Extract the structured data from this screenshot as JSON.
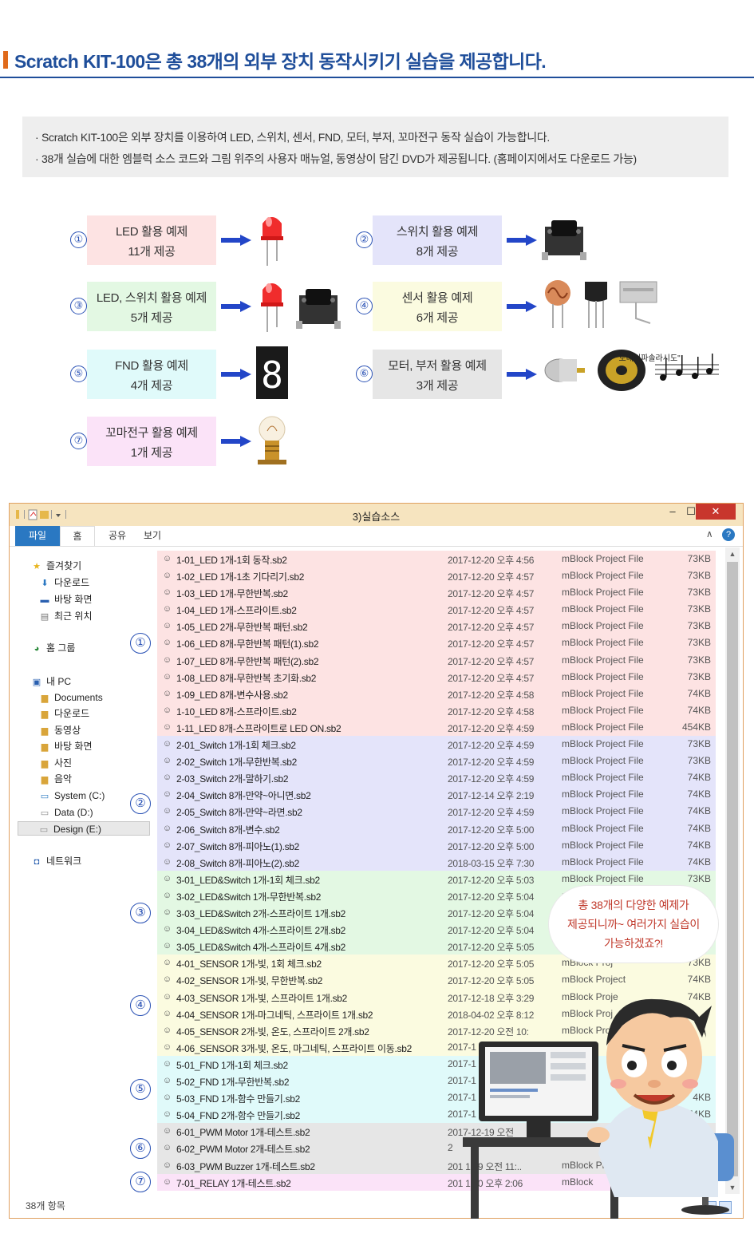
{
  "header": {
    "title": "Scratch KIT-100은 총 38개의 외부 장치 동작시키기 실습을 제공합니다."
  },
  "info": {
    "line1": "· Scratch KIT-100은 외부 장치를 이용하여 LED, 스위치, 센서, FND, 모터, 부저, 꼬마전구 동작 실습이 가능합니다.",
    "line2": "· 38개 실습에 대한 엠블럭 소스 코드와 그림 위주의 사용자 매뉴얼, 동영상이 담긴 DVD가 제공됩니다. (홈페이지에서도 다운로드 가능)"
  },
  "examples": [
    {
      "num": "①",
      "line1": "LED 활용 예제",
      "line2": "11개 제공",
      "color": "#fde3e3"
    },
    {
      "num": "②",
      "line1": "스위치 활용 예제",
      "line2": "8개 제공",
      "color": "#e4e4fa"
    },
    {
      "num": "③",
      "line1": "LED, 스위치 활용 예제",
      "line2": "5개 제공",
      "color": "#e3f8e3"
    },
    {
      "num": "④",
      "line1": "센서 활용 예제",
      "line2": "6개 제공",
      "color": "#fbfbe0"
    },
    {
      "num": "⑤",
      "line1": "FND 활용 예제",
      "line2": "4개 제공",
      "color": "#e0fafa"
    },
    {
      "num": "⑥",
      "line1": "모터, 부저 활용 예제",
      "line2": "3개 제공",
      "color": "#e6e6e6"
    },
    {
      "num": "⑦",
      "line1": "꼬마전구 활용 예제",
      "line2": "1개 제공",
      "color": "#fbe3f8"
    }
  ],
  "buzzer_label": "\"도레미파솔라시도\"",
  "led7seg": "8",
  "explorer": {
    "title": "3)실습소스",
    "tabs": {
      "file": "파일",
      "home": "홈",
      "share": "공유",
      "view": "보기"
    },
    "nav": {
      "favorites": "즐겨찾기",
      "downloads": "다운로드",
      "desktop": "바탕 화면",
      "recent": "최근 위치",
      "homegroup": "홈 그룹",
      "pc": "내 PC",
      "documents": "Documents",
      "pc_downloads": "다운로드",
      "videos": "동영상",
      "pc_desktop": "바탕 화면",
      "pictures": "사진",
      "music": "음악",
      "system": "System (C:)",
      "data": "Data (D:)",
      "design": "Design (E:)",
      "network": "네트워크"
    },
    "status": "38개 항목",
    "groups": [
      {
        "num": "①",
        "color": "#fde3e3",
        "files": [
          {
            "name": "1-01_LED 1개-1회 동작.sb2",
            "date": "2017-12-20 오후 4:56",
            "type": "mBlock Project File",
            "size": "73KB"
          },
          {
            "name": "1-02_LED 1개-1초 기다리기.sb2",
            "date": "2017-12-20 오후 4:57",
            "type": "mBlock Project File",
            "size": "73KB"
          },
          {
            "name": "1-03_LED 1개-무한반복.sb2",
            "date": "2017-12-20 오후 4:57",
            "type": "mBlock Project File",
            "size": "73KB"
          },
          {
            "name": "1-04_LED 1개-스프라이트.sb2",
            "date": "2017-12-20 오후 4:57",
            "type": "mBlock Project File",
            "size": "73KB"
          },
          {
            "name": "1-05_LED 2개-무한반복 패턴.sb2",
            "date": "2017-12-20 오후 4:57",
            "type": "mBlock Project File",
            "size": "73KB"
          },
          {
            "name": "1-06_LED 8개-무한반복 패턴(1).sb2",
            "date": "2017-12-20 오후 4:57",
            "type": "mBlock Project File",
            "size": "73KB"
          },
          {
            "name": "1-07_LED 8개-무한반복 패턴(2).sb2",
            "date": "2017-12-20 오후 4:57",
            "type": "mBlock Project File",
            "size": "73KB"
          },
          {
            "name": "1-08_LED 8개-무한반복 초기화.sb2",
            "date": "2017-12-20 오후 4:57",
            "type": "mBlock Project File",
            "size": "73KB"
          },
          {
            "name": "1-09_LED 8개-변수사용.sb2",
            "date": "2017-12-20 오후 4:58",
            "type": "mBlock Project File",
            "size": "74KB"
          },
          {
            "name": "1-10_LED 8개-스프라이트.sb2",
            "date": "2017-12-20 오후 4:58",
            "type": "mBlock Project File",
            "size": "74KB"
          },
          {
            "name": "1-11_LED 8개-스프라이트로 LED ON.sb2",
            "date": "2017-12-20 오후 4:59",
            "type": "mBlock Project File",
            "size": "454KB"
          }
        ]
      },
      {
        "num": "②",
        "color": "#e4e4fa",
        "files": [
          {
            "name": "2-01_Switch 1개-1회 체크.sb2",
            "date": "2017-12-20 오후 4:59",
            "type": "mBlock Project File",
            "size": "73KB"
          },
          {
            "name": "2-02_Switch 1개-무한반복.sb2",
            "date": "2017-12-20 오후 4:59",
            "type": "mBlock Project File",
            "size": "73KB"
          },
          {
            "name": "2-03_Switch 2개-말하기.sb2",
            "date": "2017-12-20 오후 4:59",
            "type": "mBlock Project File",
            "size": "74KB"
          },
          {
            "name": "2-04_Switch 8개-만약~아니면.sb2",
            "date": "2017-12-14 오후 2:19",
            "type": "mBlock Project File",
            "size": "74KB"
          },
          {
            "name": "2-05_Switch 8개-만약~라면.sb2",
            "date": "2017-12-20 오후 4:59",
            "type": "mBlock Project File",
            "size": "74KB"
          },
          {
            "name": "2-06_Switch 8개-변수.sb2",
            "date": "2017-12-20 오후 5:00",
            "type": "mBlock Project File",
            "size": "74KB"
          },
          {
            "name": "2-07_Switch 8개-피아노(1).sb2",
            "date": "2017-12-20 오후 5:00",
            "type": "mBlock Project File",
            "size": "74KB"
          },
          {
            "name": "2-08_Switch 8개-피아노(2).sb2",
            "date": "2018-03-15 오후 7:30",
            "type": "mBlock Project File",
            "size": "74KB"
          }
        ]
      },
      {
        "num": "③",
        "color": "#e3f8e3",
        "files": [
          {
            "name": "3-01_LED&Switch 1개-1회 체크.sb2",
            "date": "2017-12-20 오후 5:03",
            "type": "mBlock Project File",
            "size": "73KB"
          },
          {
            "name": "3-02_LED&Switch 1개-무한반복.sb2",
            "date": "2017-12-20 오후 5:04",
            "type": "m",
            "size": ""
          },
          {
            "name": "3-03_LED&Switch 2개-스프라이트 1개.sb2",
            "date": "2017-12-20 오후 5:04",
            "type": "",
            "size": ""
          },
          {
            "name": "3-04_LED&Switch 4개-스프라이트 2개.sb2",
            "date": "2017-12-20 오후 5:04",
            "type": "",
            "size": ""
          },
          {
            "name": "3-05_LED&Switch 4개-스프라이트 4개.sb2",
            "date": "2017-12-20 오후 5:05",
            "type": "",
            "size": ""
          }
        ]
      },
      {
        "num": "④",
        "color": "#fbfbe0",
        "files": [
          {
            "name": "4-01_SENSOR 1개-빛, 1회 체크.sb2",
            "date": "2017-12-20 오후 5:05",
            "type": "mBlock Proj",
            "size": "73KB"
          },
          {
            "name": "4-02_SENSOR 1개-빛, 무한반복.sb2",
            "date": "2017-12-20 오후 5:05",
            "type": "mBlock Project",
            "size": "74KB"
          },
          {
            "name": "4-03_SENSOR 1개-빛, 스프라이트 1개.sb2",
            "date": "2017-12-18 오후 3:29",
            "type": "mBlock Proje",
            "size": "74KB"
          },
          {
            "name": "4-04_SENSOR 1개-마그네틱, 스프라이트 1개.sb2",
            "date": "2018-04-02 오후 8:12",
            "type": "mBlock Proj",
            "size": ""
          },
          {
            "name": "4-05_SENSOR 2개-빛, 온도, 스프라이트 2개.sb2",
            "date": "2017-12-20 오전 10:",
            "type": "mBlock Pro",
            "size": ""
          },
          {
            "name": "4-06_SENSOR 3개-빛, 온도, 마그네틱, 스프라이트 이동.sb2",
            "date": "2017-1",
            "type": "",
            "size": ""
          }
        ]
      },
      {
        "num": "⑤",
        "color": "#e0fafa",
        "files": [
          {
            "name": "5-01_FND 1개-1회 체크.sb2",
            "date": "2017-1",
            "type": "",
            "size": ""
          },
          {
            "name": "5-02_FND 1개-무한반복.sb2",
            "date": "2017-1",
            "type": "",
            "size": ""
          },
          {
            "name": "5-03_FND 1개-함수 만들기.sb2",
            "date": "2017-1",
            "type": "",
            "size": "4KB"
          },
          {
            "name": "5-04_FND 2개-함수 만들기.sb2",
            "date": "2017-1",
            "type": "",
            "size": "74KB"
          }
        ]
      },
      {
        "num": "⑥",
        "color": "#e6e6e6",
        "files": [
          {
            "name": "6-01_PWM Motor 1개-테스트.sb2",
            "date": "2017-12-19 오전",
            "type": "",
            "size": "B"
          },
          {
            "name": "6-02_PWM Motor 2개-테스트.sb2",
            "date": "2",
            "type": "",
            "size": "B"
          },
          {
            "name": "6-03_PWM Buzzer 1개-테스트.sb2",
            "date": "201  12  9 오전 11:..",
            "type": "mBlock Projec",
            "size": "B"
          }
        ]
      },
      {
        "num": "⑦",
        "color": "#fbe3f8",
        "files": [
          {
            "name": "7-01_RELAY 1개-테스트.sb2",
            "date": "201  12  0 오후 2:06",
            "type": "mBlock",
            "size": "7KB"
          }
        ]
      }
    ]
  },
  "bubble": {
    "line1": "총 38개의 다양한 예제가",
    "line2": "제공되니까~ 여러가지 실습이",
    "line3": "가능하겠죠?!"
  },
  "colors": {
    "title_blue": "#1f4e9a",
    "accent_orange": "#e06a1b",
    "arrow_blue": "#2346c8",
    "circle_blue": "#2850b4"
  }
}
